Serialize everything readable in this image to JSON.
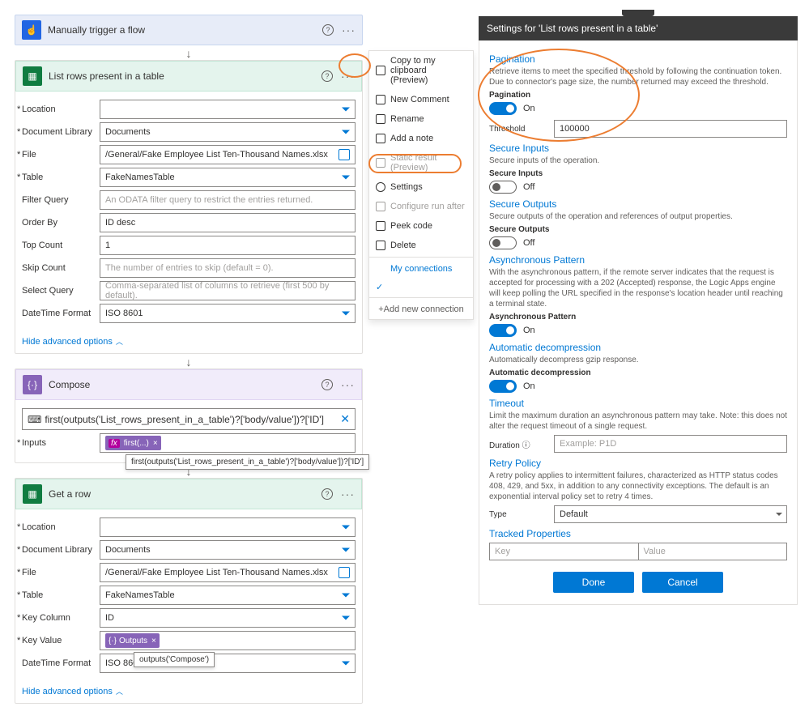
{
  "trigger": {
    "title": "Manually trigger a flow"
  },
  "arrows": {
    "down": "↓"
  },
  "listRows": {
    "title": "List rows present in a table",
    "labels": {
      "location": "Location",
      "docLib": "Document Library",
      "file": "File",
      "table": "Table",
      "filterQuery": "Filter Query",
      "orderBy": "Order By",
      "topCount": "Top Count",
      "skipCount": "Skip Count",
      "selectQuery": "Select Query",
      "dtFormat": "DateTime Format"
    },
    "values": {
      "location": "",
      "docLib": "Documents",
      "file": "/General/Fake Employee List Ten-Thousand Names.xlsx",
      "table": "FakeNamesTable",
      "orderBy": "ID desc",
      "topCount": "1",
      "dtFormat": "ISO 8601"
    },
    "placeholders": {
      "filterQuery": "An ODATA filter query to restrict the entries returned.",
      "skipCount": "The number of entries to skip (default = 0).",
      "selectQuery": "Comma-separated list of columns to retrieve (first 500 by default)."
    },
    "hideAdvanced": "Hide advanced options"
  },
  "compose": {
    "title": "Compose",
    "expression": "first(outputs('List_rows_present_in_a_table')?['body/value'])?['ID']",
    "inputsLabel": "Inputs",
    "chip": "first(...)",
    "tooltip": "first(outputs('List_rows_present_in_a_table')?['body/value'])?['ID']"
  },
  "getRow": {
    "title": "Get a row",
    "labels": {
      "location": "Location",
      "docLib": "Document Library",
      "file": "File",
      "table": "Table",
      "keyCol": "Key Column",
      "keyVal": "Key Value",
      "dtFormat": "DateTime Format"
    },
    "values": {
      "location": "",
      "docLib": "Documents",
      "file": "/General/Fake Employee List Ten-Thousand Names.xlsx",
      "table": "FakeNamesTable",
      "keyCol": "ID",
      "dtFormat": "ISO 860"
    },
    "keyValueChip": "Outputs",
    "tooltip": "outputs('Compose')",
    "hideAdvanced": "Hide advanced options"
  },
  "contextMenu": {
    "items": [
      {
        "label": "Copy to my clipboard (Preview)",
        "icon": "copy",
        "enabled": true
      },
      {
        "label": "New Comment",
        "icon": "comment",
        "enabled": true
      },
      {
        "label": "Rename",
        "icon": "rename",
        "enabled": true
      },
      {
        "label": "Add a note",
        "icon": "note",
        "enabled": true
      },
      {
        "label": "Static result (Preview)",
        "icon": "static",
        "enabled": false
      },
      {
        "label": "Settings",
        "icon": "settings",
        "enabled": true
      },
      {
        "label": "Configure run after",
        "icon": "runafter",
        "enabled": false
      },
      {
        "label": "Peek code",
        "icon": "peek",
        "enabled": true
      },
      {
        "label": "Delete",
        "icon": "delete",
        "enabled": true
      }
    ],
    "myConnections": "My connections",
    "addNew": "+Add new connection"
  },
  "settingsPanel": {
    "header": "Settings for 'List rows present in a table'",
    "pagination": {
      "title": "Pagination",
      "desc": "Retrieve items to meet the specified threshold by following the continuation token. Due to connector's page size, the number returned may exceed the threshold.",
      "label": "Pagination",
      "state": "On",
      "thresholdLabel": "Threshold",
      "threshold": "100000"
    },
    "secureInputs": {
      "title": "Secure Inputs",
      "desc": "Secure inputs of the operation.",
      "label": "Secure Inputs",
      "state": "Off"
    },
    "secureOutputs": {
      "title": "Secure Outputs",
      "desc": "Secure outputs of the operation and references of output properties.",
      "label": "Secure Outputs",
      "state": "Off"
    },
    "async": {
      "title": "Asynchronous Pattern",
      "desc": "With the asynchronous pattern, if the remote server indicates that the request is accepted for processing with a 202 (Accepted) response, the Logic Apps engine will keep polling the URL specified in the response's location header until reaching a terminal state.",
      "label": "Asynchronous Pattern",
      "state": "On"
    },
    "decomp": {
      "title": "Automatic decompression",
      "desc": "Automatically decompress gzip response.",
      "label": "Automatic decompression",
      "state": "On"
    },
    "timeout": {
      "title": "Timeout",
      "desc": "Limit the maximum duration an asynchronous pattern may take. Note: this does not alter the request timeout of a single request.",
      "label": "Duration",
      "placeholder": "Example: P1D"
    },
    "retry": {
      "title": "Retry Policy",
      "desc": "A retry policy applies to intermittent failures, characterized as HTTP status codes 408, 429, and 5xx, in addition to any connectivity exceptions. The default is an exponential interval policy set to retry 4 times.",
      "typeLabel": "Type",
      "type": "Default"
    },
    "tracked": {
      "title": "Tracked Properties",
      "key": "Key",
      "value": "Value"
    },
    "buttons": {
      "done": "Done",
      "cancel": "Cancel"
    }
  }
}
